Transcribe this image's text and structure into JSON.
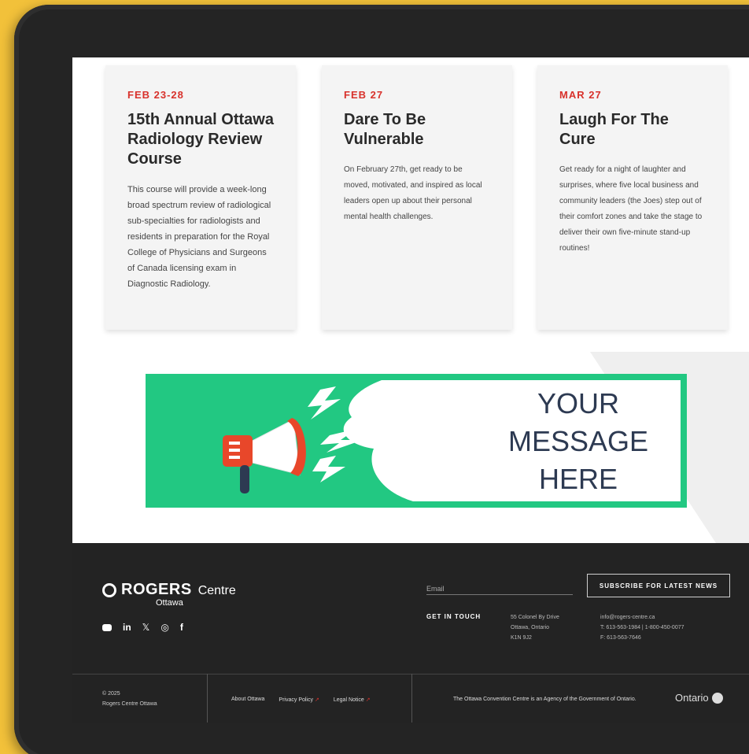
{
  "events": [
    {
      "date": "FEB 23-28",
      "title": "15th Annual Ottawa Radiology Review Course",
      "description": "This course will provide a week-long broad spectrum review of radiological sub-specialties for radiologists and residents in preparation for the Royal College of Physicians and Surgeons of Canada licensing exam in Diagnostic Radiology."
    },
    {
      "date": "FEB 27",
      "title": "Dare To Be Vulnerable",
      "description": "On February 27th, get ready to be moved, motivated, and inspired as local leaders open up about their personal mental health challenges."
    },
    {
      "date": "MAR 27",
      "title": "Laugh For The Cure",
      "description": "Get ready for a night of laughter and surprises, where five local business and community leaders (the Joes) step out of their comfort zones and take the stage to deliver their own five-minute stand-up routines!"
    }
  ],
  "banner": {
    "line1": "YOUR",
    "line2": "MESSAGE",
    "line3": "HERE",
    "icon": "megaphone-icon",
    "bg_color": "#22c882",
    "text_color": "#2d3a52"
  },
  "footer": {
    "brand": "ROGERS",
    "brand_sub": "Centre",
    "brand_city": "Ottawa",
    "socials": [
      "youtube-icon",
      "linkedin-icon",
      "x-icon",
      "instagram-icon",
      "facebook-icon"
    ],
    "email_placeholder": "Email",
    "subscribe_label": "SUBSCRIBE FOR LATEST NEWS",
    "get_in_touch": "GET IN TOUCH",
    "address_line1": "55 Colonel By Drive",
    "address_line2": "Ottawa, Ontario",
    "address_line3": "K1N 9J2",
    "contact_email": "info@rogers-centre.ca",
    "contact_phone": "T: 613-563-1984 | 1-800-450-0077",
    "contact_fax": "F: 613-563-7646",
    "copyright_year": "© 2025",
    "copyright_name": "Rogers Centre Ottawa",
    "link_about": "About Ottawa",
    "link_privacy": "Privacy Policy",
    "link_legal": "Legal Notice",
    "agency_text": "The Ottawa Convention Centre is an Agency of the Government of Ontario.",
    "ontario_label": "Ontario",
    "accent_color": "#d8322c"
  }
}
